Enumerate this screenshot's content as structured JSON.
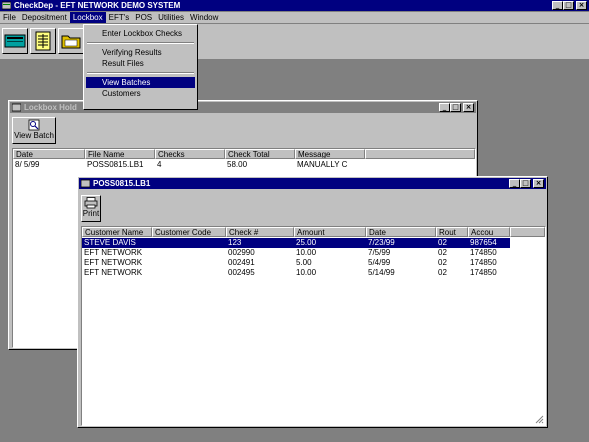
{
  "app": {
    "title": "CheckDep - EFT NETWORK DEMO SYSTEM"
  },
  "menu": [
    "File",
    "Depositment",
    "Lockbox",
    "EFT's",
    "POS",
    "Utilities",
    "Window"
  ],
  "lockbox_menu": {
    "items": [
      "Enter Lockbox Checks",
      "Verifying Results",
      "Result Files",
      "View Batches",
      "Customers"
    ],
    "selected": "View Batches"
  },
  "toolbar": {
    "icons": [
      "calculator-icon",
      "ledger-icon",
      "folder-icon"
    ]
  },
  "lockbox_window": {
    "title": "Lockbox Hold",
    "view_batch_label": "View Batch",
    "columns": [
      "Date",
      "File Name",
      "Checks",
      "Check Total",
      "Message"
    ],
    "rows": [
      [
        "8/ 5/99",
        "POSS0815.LB1",
        "4",
        "58.00",
        "MANUALLY C"
      ]
    ]
  },
  "pos_window": {
    "title": "POSS0815.LB1",
    "print_label": "Print",
    "columns": [
      "Customer Name",
      "Customer Code",
      "Check #",
      "Amount",
      "Date",
      "Rout",
      "Accou"
    ],
    "rows": [
      [
        "STEVE DAVIS",
        "",
        "123",
        "25.00",
        "7/23/99",
        "02",
        "987654"
      ],
      [
        "EFT NETWORK",
        "",
        "002990",
        "10.00",
        "7/5/99",
        "02",
        "174850"
      ],
      [
        "EFT NETWORK",
        "",
        "002491",
        "5.00",
        "5/4/99",
        "02",
        "174850"
      ],
      [
        "EFT NETWORK",
        "",
        "002495",
        "10.00",
        "5/14/99",
        "02",
        "174850"
      ]
    ]
  }
}
